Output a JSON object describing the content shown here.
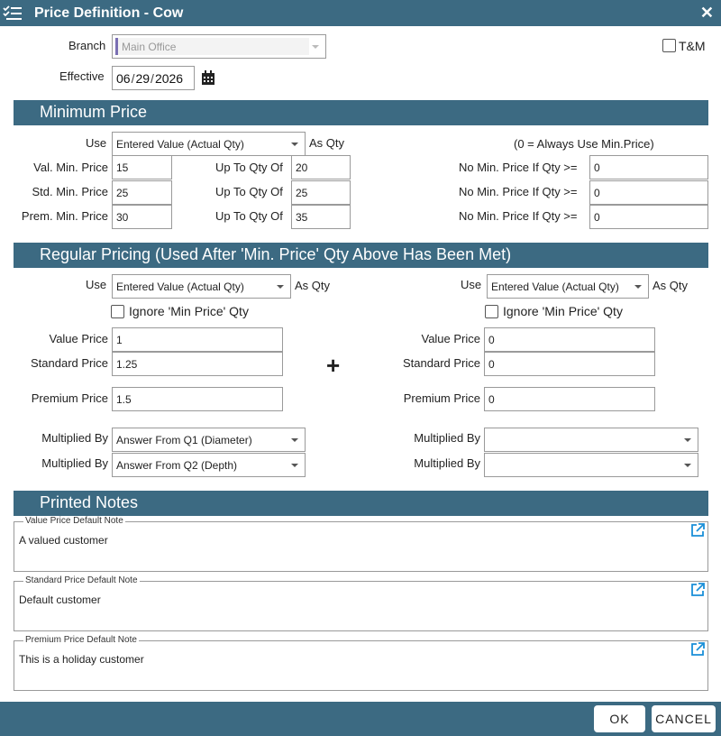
{
  "dialog": {
    "title": "Price Definition - Cow",
    "icons": {
      "title": "checklist-icon",
      "close": "close-icon"
    }
  },
  "header": {
    "branch_label": "Branch",
    "branch_value": "Main Office",
    "tm_label": "T&M",
    "effective_label": "Effective",
    "effective_month": "06",
    "effective_day": "29",
    "effective_year": "2026",
    "date_sep": "/",
    "calendar_icon": "calendar-icon"
  },
  "min_price": {
    "title": "Minimum Price",
    "use_label": "Use",
    "use_value": "Entered Value (Actual Qty)",
    "as_qty": "As Qty",
    "note": "(0 = Always Use Min.Price)",
    "rows": [
      {
        "label": "Val. Min. Price",
        "price": "15",
        "upto_label": "Up To Qty Of",
        "upto": "20",
        "nomin_label": "No Min. Price If Qty >=",
        "nomin": "0"
      },
      {
        "label": "Std. Min. Price",
        "price": "25",
        "upto_label": "Up To Qty Of",
        "upto": "25",
        "nomin_label": "No Min. Price If Qty >=",
        "nomin": "0"
      },
      {
        "label": "Prem. Min. Price",
        "price": "30",
        "upto_label": "Up To Qty Of",
        "upto": "35",
        "nomin_label": "No Min. Price If Qty >=",
        "nomin": "0"
      }
    ]
  },
  "regular": {
    "title": "Regular Pricing (Used After 'Min. Price' Qty Above Has Been Met)",
    "plus": "+",
    "left": {
      "use_label": "Use",
      "use_value": "Entered Value (Actual Qty)",
      "as_qty": "As Qty",
      "ignore_label": "Ignore 'Min Price' Qty",
      "value_label": "Value Price",
      "value": "1",
      "standard_label": "Standard Price",
      "standard": "1.25",
      "premium_label": "Premium Price",
      "premium": "1.5",
      "mult1_label": "Multiplied By",
      "mult1": "Answer From Q1 (Diameter)",
      "mult2_label": "Multiplied By",
      "mult2": "Answer From Q2 (Depth)"
    },
    "right": {
      "use_label": "Use",
      "use_value": "Entered Value (Actual Qty)",
      "as_qty": "As Qty",
      "ignore_label": "Ignore 'Min Price' Qty",
      "value_label": "Value Price",
      "value": "0",
      "standard_label": "Standard Price",
      "standard": "0",
      "premium_label": "Premium Price",
      "premium": "0",
      "mult1_label": "Multiplied By",
      "mult1": "",
      "mult2_label": "Multiplied By",
      "mult2": ""
    }
  },
  "notes": {
    "title": "Printed Notes",
    "items": [
      {
        "legend": "Value Price Default Note",
        "text": "A valued customer"
      },
      {
        "legend": "Standard Price Default Note",
        "text": "Default customer"
      },
      {
        "legend": "Premium Price Default Note",
        "text": "This is a holiday customer"
      }
    ],
    "open_icon": "external-link-icon"
  },
  "footer": {
    "ok": "OK",
    "cancel": "CANCEL"
  },
  "colors": {
    "accent": "#3c6a82",
    "border": "#9a9a9a",
    "link_icon": "#1a8fd8"
  }
}
